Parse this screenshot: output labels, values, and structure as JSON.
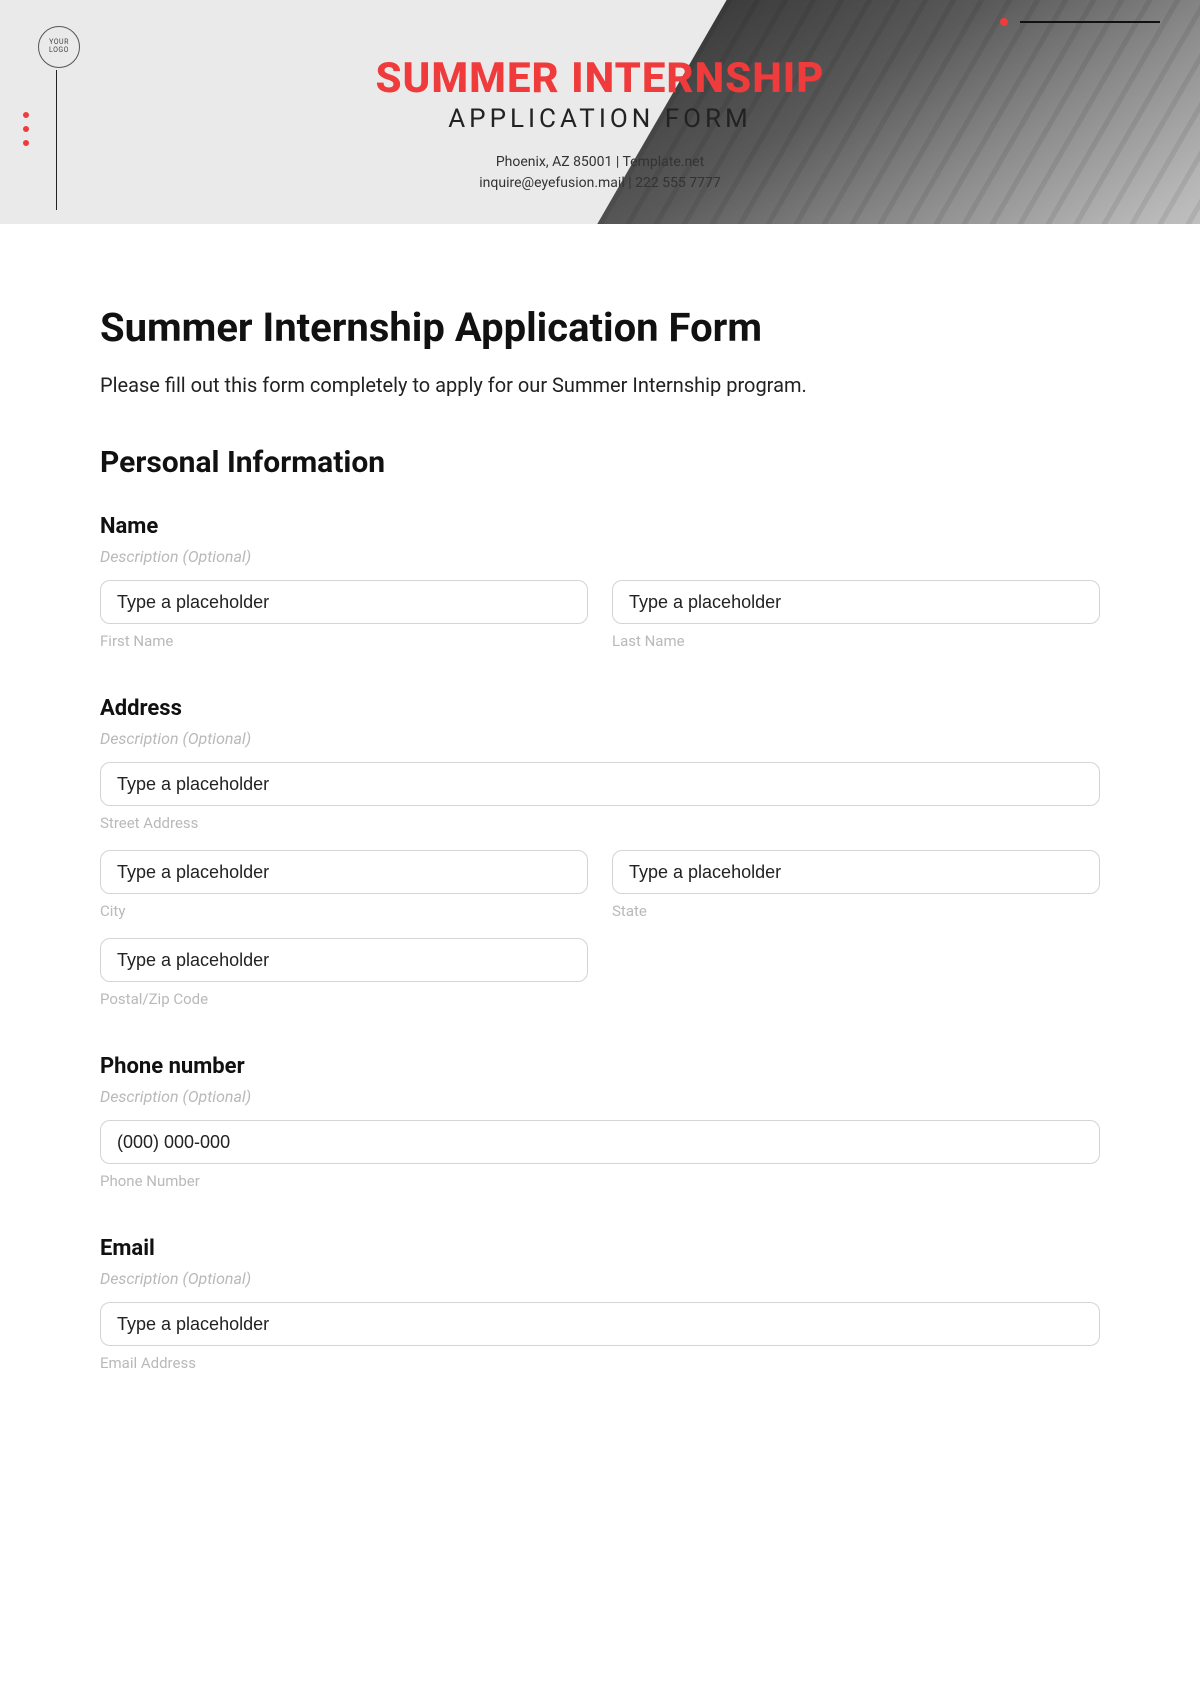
{
  "hero": {
    "logo_text": "YOUR LOGO",
    "title": "SUMMER INTERNSHIP",
    "subtitle": "APPLICATION FORM",
    "meta_line1": "Phoenix, AZ 85001 | Template.net",
    "meta_line2": "inquire@eyefusion.mail | 222 555 7777"
  },
  "page": {
    "heading": "Summer Internship Application Form",
    "intro": "Please fill out this form completely to apply for our Summer Internship program.",
    "section": "Personal Information"
  },
  "common": {
    "desc_optional": "Description (Optional)",
    "placeholder": "Type a placeholder"
  },
  "fields": {
    "name": {
      "label": "Name",
      "first_sub": "First Name",
      "last_sub": "Last Name"
    },
    "address": {
      "label": "Address",
      "street_sub": "Street Address",
      "city_sub": "City",
      "state_sub": "State",
      "zip_sub": "Postal/Zip Code"
    },
    "phone": {
      "label": "Phone number",
      "placeholder": "(000) 000-000",
      "sub": "Phone Number"
    },
    "email": {
      "label": "Email",
      "sub": "Email Address"
    }
  }
}
